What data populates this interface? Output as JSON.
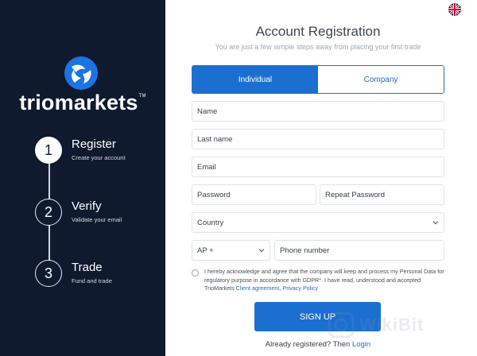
{
  "brand": {
    "name": "triomarkets",
    "tm": "TM"
  },
  "steps": [
    {
      "number": "1",
      "title": "Register",
      "subtitle": "Create your account"
    },
    {
      "number": "2",
      "title": "Verify",
      "subtitle": "Validate your email"
    },
    {
      "number": "3",
      "title": "Trade",
      "subtitle": "Fund and trade"
    }
  ],
  "form": {
    "title": "Account Registration",
    "subtitle": "You are just a few simple steps away from placing your first trade",
    "tabs": [
      {
        "label": "Individual"
      },
      {
        "label": "Company"
      }
    ],
    "placeholders": {
      "name": "Name",
      "last_name": "Last name",
      "email": "Email",
      "password": "Password",
      "repeat_password": "Repeat Password",
      "phone": "Phone number"
    },
    "country_label": "Country",
    "phone_code": "AP +",
    "consent_text": "I hereby acknowledge and agree that the company will keep and process my Personal Data for regulatory purpose in accordance with GDPR*. I have read, understood and accepted TrioMarkets",
    "client_agreement": "Client agreement",
    "separator": ",",
    "privacy_policy": "Privacy Policy",
    "signup_label": "SIGN UP",
    "already_text": "Already registered? Then",
    "login_label": "Login"
  },
  "colors": {
    "sidebar": "#0f1a2e",
    "accent": "#1b6fd1",
    "logo_blue": "#1b74e4"
  },
  "watermark": "WikiBit"
}
